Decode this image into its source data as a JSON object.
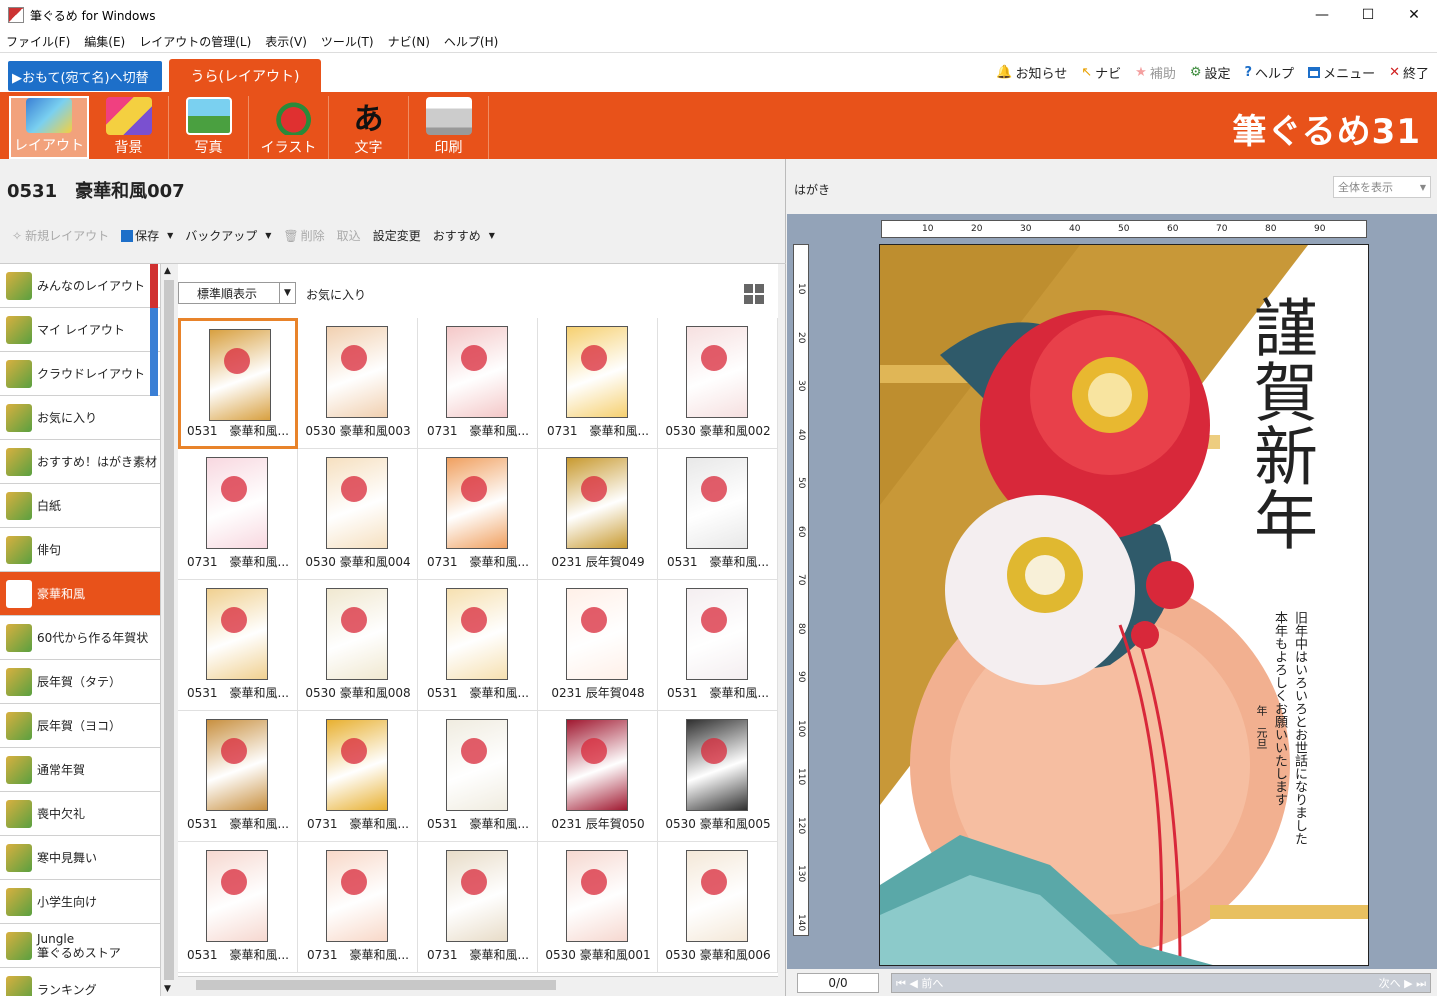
{
  "window": {
    "title": "筆ぐるめ for Windows",
    "controls": [
      "—",
      "☐",
      "✕"
    ]
  },
  "menu": [
    "ファイル(F)",
    "編集(E)",
    "レイアウトの管理(L)",
    "表示(V)",
    "ツール(T)",
    "ナビ(N)",
    "ヘルプ(H)"
  ],
  "tabs": {
    "switch_front": "▶おもて(宛て名)へ切替",
    "back_layout": "うら(レイアウト)"
  },
  "topright": [
    {
      "label": "お知らせ",
      "icon": "bell-icon",
      "color": "#e8521a"
    },
    {
      "label": "ナビ",
      "icon": "navi-arrow-icon",
      "color": "#e8a000"
    },
    {
      "label": "補助",
      "icon": "star-icon",
      "color": "#f4a0a0"
    },
    {
      "label": "設定",
      "icon": "gear-icon",
      "color": "#3a8a3a"
    },
    {
      "label": "ヘルプ",
      "icon": "help-icon",
      "color": "#1d6fc9"
    },
    {
      "label": "メニュー",
      "icon": "window-icon",
      "color": "#1d6fc9"
    },
    {
      "label": "終了",
      "icon": "close-icon",
      "color": "#d02020"
    }
  ],
  "ribbon": {
    "buttons": [
      "レイアウト",
      "背景",
      "写真",
      "イラスト",
      "文字",
      "印刷"
    ],
    "brand": "筆ぐるめ31",
    "accent": "#e8521a"
  },
  "layout": {
    "title": "0531　豪華和風007"
  },
  "toolbar": {
    "new_layout": "新規レイアウト",
    "save": "保存",
    "backup": "バックアップ",
    "delete": "削除",
    "import": "取込",
    "settings": "設定変更",
    "recommend": "おすすめ"
  },
  "categories": [
    {
      "label": "みんなのレイアウト",
      "bar": "#d03030"
    },
    {
      "label": "マイ レイアウト",
      "bar": "#3a7fd5"
    },
    {
      "label": "クラウドレイアウト",
      "bar": "#3a7fd5"
    },
    {
      "label": "お気に入り",
      "bar": ""
    },
    {
      "label": "おすすめ！はがき素材",
      "bar": ""
    },
    {
      "label": "白紙",
      "bar": ""
    },
    {
      "label": "俳句",
      "bar": ""
    },
    {
      "label": "豪華和風",
      "bar": ""
    },
    {
      "label": "60代から作る年賀状",
      "bar": ""
    },
    {
      "label": "辰年賀（タテ）",
      "bar": ""
    },
    {
      "label": "辰年賀（ヨコ）",
      "bar": ""
    },
    {
      "label": "通常年賀",
      "bar": ""
    },
    {
      "label": "喪中欠礼",
      "bar": ""
    },
    {
      "label": "寒中見舞い",
      "bar": ""
    },
    {
      "label": "小学生向け",
      "bar": ""
    },
    {
      "label": "Jungle\n筆ぐるめストア",
      "bar": ""
    },
    {
      "label": "ランキング",
      "bar": ""
    }
  ],
  "gallery": {
    "sort": "標準順表示",
    "favorites": "お気に入り",
    "items": [
      {
        "caption": "0531　豪華和風...",
        "tone": "#d8a040"
      },
      {
        "caption": "0530 豪華和風003",
        "tone": "#f1d0b0"
      },
      {
        "caption": "0731　豪華和風...",
        "tone": "#f4c8c8"
      },
      {
        "caption": "0731　豪華和風...",
        "tone": "#f6d070"
      },
      {
        "caption": "0530 豪華和風002",
        "tone": "#f6e0e0"
      },
      {
        "caption": "0731　豪華和風...",
        "tone": "#f8d8e0"
      },
      {
        "caption": "0530 豪華和風004",
        "tone": "#f6e0c0"
      },
      {
        "caption": "0731　豪華和風...",
        "tone": "#f0a060"
      },
      {
        "caption": "0231 辰年賀049",
        "tone": "#c89a30"
      },
      {
        "caption": "0531　豪華和風...",
        "tone": "#e8e8e8"
      },
      {
        "caption": "0531　豪華和風...",
        "tone": "#f0d090"
      },
      {
        "caption": "0530 豪華和風008",
        "tone": "#f0e8d0"
      },
      {
        "caption": "0531　豪華和風...",
        "tone": "#f6e0b0"
      },
      {
        "caption": "0231 辰年賀048",
        "tone": "#fff0e8"
      },
      {
        "caption": "0531　豪華和風...",
        "tone": "#f4eef0"
      },
      {
        "caption": "0531　豪華和風...",
        "tone": "#c89040"
      },
      {
        "caption": "0731　豪華和風...",
        "tone": "#e8b030"
      },
      {
        "caption": "0531　豪華和風...",
        "tone": "#f0ece0"
      },
      {
        "caption": "0231 辰年賀050",
        "tone": "#a01830"
      },
      {
        "caption": "0530 豪華和風005",
        "tone": "#303030"
      },
      {
        "caption": "0531　豪華和風...",
        "tone": "#f6d8d0"
      },
      {
        "caption": "0731　豪華和風...",
        "tone": "#f8d8c8"
      },
      {
        "caption": "0731　豪華和風...",
        "tone": "#e8dcc8"
      },
      {
        "caption": "0530 豪華和風001",
        "tone": "#f6d8d0"
      },
      {
        "caption": "0530 豪華和風006",
        "tone": "#f4e8d8"
      }
    ]
  },
  "preview": {
    "paper": "はがき",
    "zoom": "全体を表示",
    "page": "0/0",
    "prev": "前へ",
    "next": "次へ",
    "greeting": "謹賀新年",
    "message_line1": "旧年中はいろいろとお世話になりました",
    "message_line2": "本年もよろしくお願いいたします",
    "date": "年　元旦"
  },
  "ruler_h": [
    "10",
    "20",
    "30",
    "40",
    "50",
    "60",
    "70",
    "80",
    "90"
  ],
  "ruler_v": [
    "10",
    "20",
    "30",
    "40",
    "50",
    "60",
    "70",
    "80",
    "90",
    "100",
    "110",
    "120",
    "130",
    "140"
  ]
}
